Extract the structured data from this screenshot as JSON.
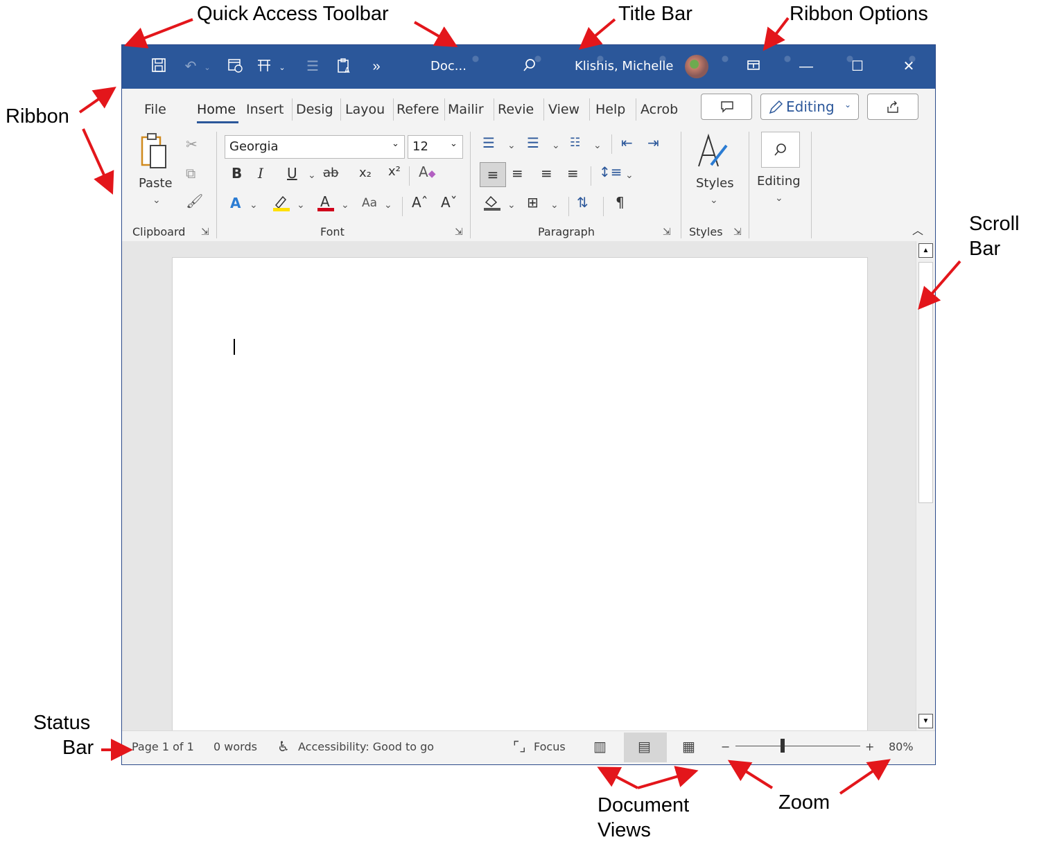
{
  "annotations": {
    "quick_access_toolbar": "Quick Access Toolbar",
    "title_bar": "Title Bar",
    "ribbon_options": "Ribbon Options",
    "ribbon": "Ribbon",
    "scroll_bar_line1": "Scroll",
    "scroll_bar_line2": "Bar",
    "status_bar_line1": "Status",
    "status_bar_line2": "Bar",
    "document_views_line1": "Document",
    "document_views_line2": "Views",
    "zoom": "Zoom"
  },
  "titlebar": {
    "doc_name": "Doc...",
    "user_name": "Klishis, Michelle",
    "more_glyph": "»",
    "min_glyph": "—",
    "max_glyph": "☐",
    "close_glyph": "✕"
  },
  "tabs": [
    "File",
    "Home",
    "Insert",
    "Desig",
    "Layou",
    "Refere",
    "Mailir",
    "Revie",
    "View",
    "Help",
    "Acrob"
  ],
  "ribbon_buttons": {
    "editing": "Editing"
  },
  "clipboard": {
    "paste": "Paste",
    "label": "Clipboard"
  },
  "font": {
    "name": "Georgia",
    "size": "12",
    "bold": "B",
    "italic": "I",
    "underline": "U",
    "strike": "ab",
    "subscript": "x₂",
    "superscript": "x²",
    "change_case": "Aa",
    "grow": "Aˆ",
    "shrink": "Aˇ",
    "label": "Font"
  },
  "paragraph": {
    "label": "Paragraph",
    "pilcrow": "¶"
  },
  "styles": {
    "button": "Styles",
    "label": "Styles"
  },
  "editing_group": {
    "button": "Editing"
  },
  "statusbar": {
    "page": "Page 1 of 1",
    "words": "0 words",
    "accessibility": "Accessibility: Good to go",
    "focus": "Focus",
    "zoom_minus": "−",
    "zoom_plus": "+",
    "zoom_level": "80%"
  },
  "colors": {
    "titlebar": "#2b579a",
    "arrow": "#e3161b",
    "highlight_yellow": "#ffe000",
    "font_red": "#d0021b"
  },
  "icons": [
    "save-icon",
    "undo-icon",
    "calendar-icon",
    "layout-icon",
    "align-icon",
    "clipboard-a-icon",
    "search-icon",
    "ribbon-display-icon",
    "cut-icon",
    "copy-icon",
    "format-painter-icon",
    "text-effects-icon",
    "highlighter-icon",
    "font-color-icon",
    "clear-format-icon",
    "bullets-icon",
    "numbering-icon",
    "multilevel-icon",
    "indent-icon",
    "shading-icon",
    "borders-icon",
    "sort-icon",
    "line-spacing-icon",
    "styles-icon",
    "find-icon",
    "comment-icon",
    "pencil-icon",
    "share-icon",
    "accessibility-icon",
    "focus-icon",
    "read-mode-icon",
    "print-layout-icon",
    "web-layout-icon"
  ]
}
